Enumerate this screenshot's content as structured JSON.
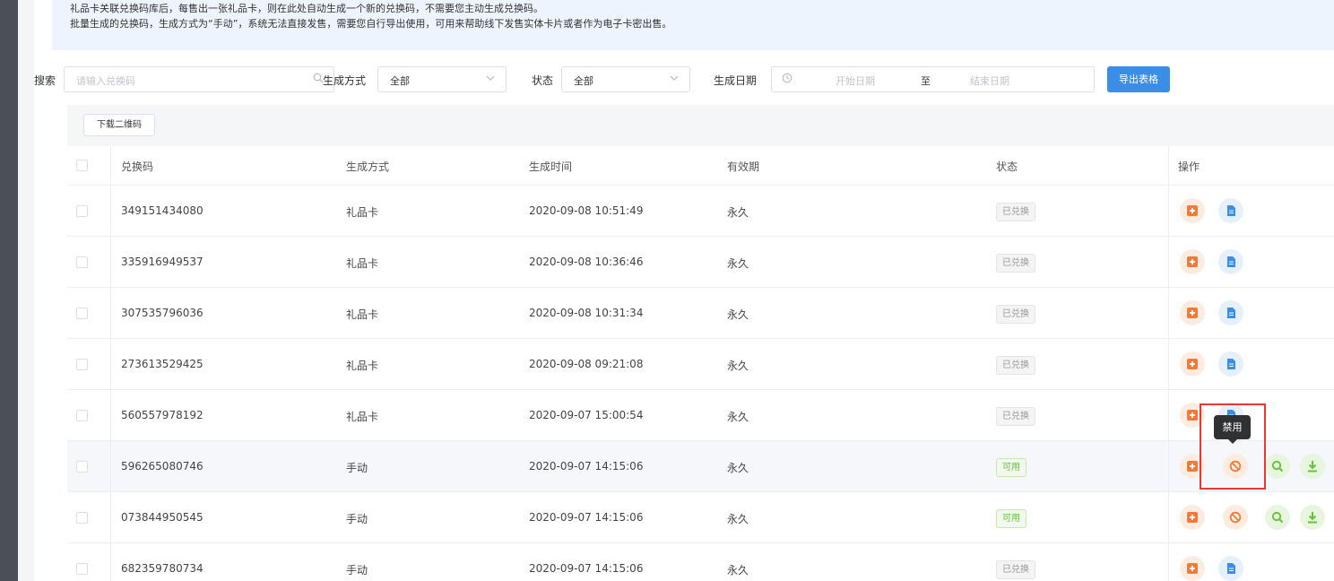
{
  "notice": {
    "line1": "礼品卡关联兑换码库后，每售出一张礼品卡，则在此处自动生成一个新的兑换码，不需要您主动生成兑换码。",
    "line2": "批量生成的兑换码，生成方式为“手动”，系统无法直接发售，需要您自行导出使用，可用来帮助线下发售实体卡片或者作为电子卡密出售。"
  },
  "filters": {
    "search_label": "搜索",
    "search_placeholder": "请输入兑换码",
    "method_label": "生成方式",
    "method_value": "全部",
    "status_label": "状态",
    "status_value": "全部",
    "date_label": "生成日期",
    "start_placeholder": "开始日期",
    "date_sep": "至",
    "end_placeholder": "结束日期",
    "export_label": "导出表格"
  },
  "toolbar": {
    "download_qr_label": "下载二维码"
  },
  "table": {
    "headers": [
      "兑换码",
      "生成方式",
      "生成时间",
      "有效期",
      "状态",
      "操作"
    ],
    "rows": [
      {
        "code": "349151434080",
        "method": "礼品卡",
        "time": "2020-09-08 10:51:49",
        "validity": "永久",
        "status": "已兑换",
        "available": false
      },
      {
        "code": "335916949537",
        "method": "礼品卡",
        "time": "2020-09-08 10:36:46",
        "validity": "永久",
        "status": "已兑换",
        "available": false
      },
      {
        "code": "307535796036",
        "method": "礼品卡",
        "time": "2020-09-08 10:31:34",
        "validity": "永久",
        "status": "已兑换",
        "available": false
      },
      {
        "code": "273613529425",
        "method": "礼品卡",
        "time": "2020-09-08 09:21:08",
        "validity": "永久",
        "status": "已兑换",
        "available": false
      },
      {
        "code": "560557978192",
        "method": "礼品卡",
        "time": "2020-09-07 15:00:54",
        "validity": "永久",
        "status": "已兑换",
        "available": false
      },
      {
        "code": "596265080746",
        "method": "手动",
        "time": "2020-09-07 14:15:06",
        "validity": "永久",
        "status": "可用",
        "available": true
      },
      {
        "code": "073844950545",
        "method": "手动",
        "time": "2020-09-07 14:15:06",
        "validity": "永久",
        "status": "可用",
        "available": true
      },
      {
        "code": "682359780734",
        "method": "手动",
        "time": "2020-09-07 14:15:06",
        "validity": "永久",
        "status": "已兑换",
        "available": false
      }
    ]
  },
  "tooltip": {
    "disable_label": "禁用"
  },
  "colors": {
    "primary": "#3a8ee6",
    "orange": "#f27a3d",
    "blue": "#3a8ee6",
    "green": "#67c23a",
    "highlight_box": "#e53935"
  },
  "icons": {
    "op_add": "add-square-icon",
    "op_doc": "document-icon",
    "op_disable": "ban-icon",
    "op_search": "search-icon",
    "op_download": "download-icon"
  }
}
